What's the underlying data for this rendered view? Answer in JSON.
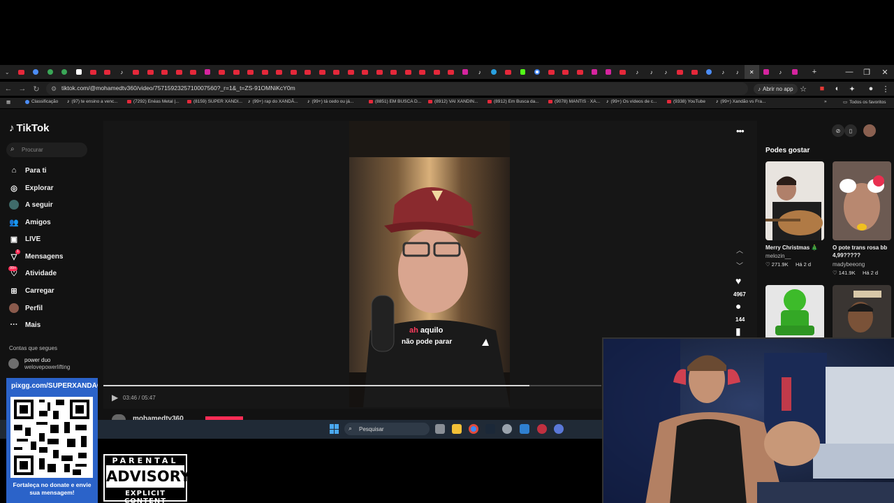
{
  "browser": {
    "url": "tiktok.com/@mohamedtv360/video/7571592325710007560?_r=1&_t=ZS-91OMNiKcY0m",
    "open_app_label": "Abrir no app",
    "tab_icons": [
      "yt",
      "bl",
      "gr",
      "gr",
      "wt",
      "yt",
      "yt",
      "tt",
      "yt",
      "yt",
      "yt",
      "yt",
      "yt",
      "ig",
      "yt",
      "yt",
      "yt",
      "yt",
      "yt",
      "yt",
      "yt",
      "yt",
      "yt",
      "yt",
      "yt",
      "yt",
      "yt",
      "yt",
      "yt",
      "yt",
      "yt",
      "ig",
      "tt",
      "tg",
      "yt",
      "kk",
      "gg",
      "yt",
      "yt",
      "yt",
      "ig",
      "ig",
      "yt",
      "tt",
      "tt",
      "tt",
      "yt",
      "yt",
      "bl",
      "tt",
      "tt",
      "active",
      "ig",
      "tt",
      "ig"
    ],
    "bookmarks": [
      {
        "icon": "g",
        "label": "Classificação"
      },
      {
        "icon": "t",
        "label": "(97) te ensino a venc..."
      },
      {
        "icon": "y",
        "label": "(7292) Enéas Metal |..."
      },
      {
        "icon": "y",
        "label": "(8159) SUPER XANDI..."
      },
      {
        "icon": "t",
        "label": "(99+) rap do XANDÃ..."
      },
      {
        "icon": "t",
        "label": "(99+) tá cedo ou já..."
      },
      {
        "icon": "y",
        "label": "(8851) EM BUSCA D..."
      },
      {
        "icon": "y",
        "label": "(8912) VAI XANDIN..."
      },
      {
        "icon": "y",
        "label": "(8912) Em Busca da..."
      },
      {
        "icon": "y",
        "label": "(9078) MANTIS · XA..."
      },
      {
        "icon": "t",
        "label": "(99+) Os vídeos de c..."
      },
      {
        "icon": "y",
        "label": "(9338) YouTube"
      },
      {
        "icon": "t",
        "label": "(99+) Xandão vs Fra..."
      }
    ],
    "all_bookmarks_label": "Todos os favoritos"
  },
  "tiktok": {
    "logo": "TikTok",
    "search_placeholder": "Procurar",
    "nav": [
      {
        "icon": "home-icon",
        "glyph": "⌂",
        "label": "Para ti"
      },
      {
        "icon": "explore-icon",
        "glyph": "◎",
        "label": "Explorar"
      },
      {
        "icon": "avatar",
        "glyph": "",
        "label": "A seguir"
      },
      {
        "icon": "friends-icon",
        "glyph": "👥",
        "label": "Amigos"
      },
      {
        "icon": "live-icon",
        "glyph": "▣",
        "label": "LIVE"
      },
      {
        "icon": "messages-icon",
        "glyph": "▽",
        "label": "Mensagens",
        "badge": "1"
      },
      {
        "icon": "activity-icon",
        "glyph": "♡",
        "label": "Atividade",
        "badge": "99+"
      },
      {
        "icon": "upload-icon",
        "glyph": "⊞",
        "label": "Carregar"
      },
      {
        "icon": "profile-avatar",
        "glyph": "",
        "label": "Perfil"
      },
      {
        "icon": "more-icon",
        "glyph": "···",
        "label": "Mais"
      }
    ],
    "following_title": "Contas que segues",
    "following": {
      "name": "power duo",
      "user": "welovepowerlifting"
    },
    "captions": {
      "highlight": "ah",
      "line1_rest": " aquilo",
      "line2": "não pode parar"
    },
    "likes": "4967",
    "comments": "144",
    "time": "03:46 / 05:47",
    "progress": 0.855,
    "author": "mohamedtv360",
    "recommend_title": "Podes gostar",
    "recommendations": [
      {
        "title": "Merry Christmas 🎄",
        "user": "melozin__",
        "likes": "♡ 271.9K",
        "age": "Há 2 d"
      },
      {
        "title": "O pote trans rosa bb 4,99?????",
        "user": "madybeeong",
        "likes": "♡ 141.9K",
        "age": "Há 2 d"
      }
    ]
  },
  "taskbar": {
    "search_label": "Pesquisar"
  },
  "overlay": {
    "qr_url": "pixgg.com/SUPERXANDÃO",
    "qr_message": "Fortaleça no donate e envie sua mensagem!",
    "advisory_top": "PARENTAL",
    "advisory_mid": "ADVISORY",
    "advisory_bottom": "EXPLICIT CONTENT"
  }
}
